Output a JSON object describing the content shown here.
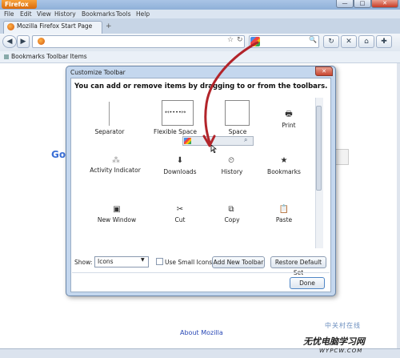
{
  "window": {
    "app_button": "Firefox",
    "min_glyph": "—",
    "max_glyph": "□",
    "close_glyph": "✕"
  },
  "menu": [
    "File",
    "Edit",
    "View",
    "History",
    "Bookmarks",
    "Tools",
    "Help"
  ],
  "tab": {
    "title": "Mozilla Firefox Start Page",
    "new_tab_glyph": "+"
  },
  "nav": {
    "back_glyph": "◀",
    "forward_glyph": "▶",
    "star_glyph": "☆",
    "reload_glyph": "↻",
    "search_glyph": "🔍",
    "stop_glyph": "✕",
    "home_glyph": "⌂",
    "addon_glyph": "✚"
  },
  "bookmarks_bar": {
    "label": "Bookmarks Toolbar Items"
  },
  "page": {
    "google_fragment": "Go",
    "search_fragment": "rch",
    "about_link": "About Mozilla"
  },
  "dialog": {
    "title": "Customize Toolbar",
    "close_glyph": "✕",
    "heading": "You can add or remove items by dragging to or from the toolbars.",
    "items": [
      {
        "label": "Separator",
        "icon": "separator"
      },
      {
        "label": "Flexible Space",
        "icon": "flexible-space",
        "glyph": "↤••••↦"
      },
      {
        "label": "Space",
        "icon": "space"
      },
      {
        "label": "Print",
        "icon": "print",
        "glyph": "🖶"
      },
      {
        "label": "Activity Indicator",
        "icon": "spinner",
        "glyph": "⁂"
      },
      {
        "label": "Downloads",
        "icon": "download",
        "glyph": "⬇"
      },
      {
        "label": "History",
        "icon": "clock",
        "glyph": "⏲"
      },
      {
        "label": "Bookmarks",
        "icon": "bookmark",
        "glyph": "★"
      },
      {
        "label": "New Window",
        "icon": "new-window",
        "glyph": "▣"
      },
      {
        "label": "Cut",
        "icon": "scissors",
        "glyph": "✂"
      },
      {
        "label": "Copy",
        "icon": "copy",
        "glyph": "⧉"
      },
      {
        "label": "Paste",
        "icon": "paste",
        "glyph": "📋"
      }
    ],
    "drag_preview_glyph": "⌕",
    "show_label": "Show:",
    "show_value": "Icons",
    "small_icons_label": "Use Small Icons",
    "add_toolbar_label": "Add New Toolbar",
    "restore_label": "Restore Default Set",
    "done_label": "Done"
  },
  "watermark": {
    "top": "中关村在线",
    "bottom": "无忧电脑学习网",
    "url": "WYPCW.COM"
  },
  "colors": {
    "firefox_orange": "#e07b17",
    "drag_arrow": "#b2242a",
    "link": "#2a49b6"
  }
}
